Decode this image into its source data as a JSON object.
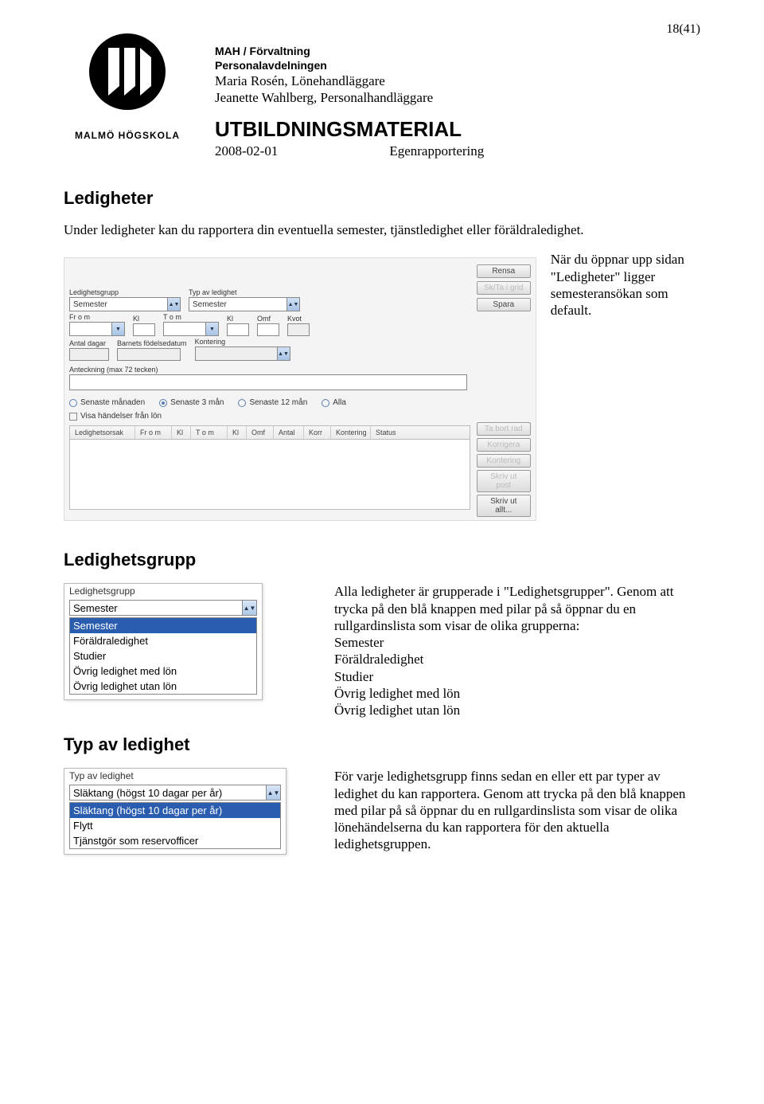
{
  "page_number": "18(41)",
  "logo_text": "MALMÖ HÖGSKOLA",
  "header": {
    "org": "MAH / Förvaltning",
    "dept": "Personalavdelningen",
    "line1": "Maria Rosén, Lönehandläggare",
    "line2": "Jeanette Wahlberg, Personalhandläggare",
    "doc_title": "UTBILDNINGSMATERIAL",
    "date": "2008-02-01",
    "subject": "Egenrapportering"
  },
  "section1": {
    "heading": "Ledigheter",
    "intro": "Under ledigheter kan du rapportera din eventuella semester, tjänstledighet eller föräldraledighet.",
    "side_note": "När du öppnar upp sidan \"Ledigheter\" ligger semesteransökan som default."
  },
  "form": {
    "labels": {
      "ledighetsgrupp": "Ledighetsgrupp",
      "typ_av_ledighet": "Typ av ledighet",
      "from": "Fr o m",
      "kl1": "Kl",
      "tom": "T o m",
      "kl2": "Kl",
      "omf": "Omf",
      "kvot": "Kvot",
      "antal_dagar": "Antal dagar",
      "barnets_fodelsedatum": "Barnets födelsedatum",
      "kontering": "Kontering",
      "anteckning": "Anteckning (max 72 tecken)"
    },
    "values": {
      "ledighetsgrupp": "Semester",
      "typ_av_ledighet": "Semester"
    },
    "buttons": {
      "rensa": "Rensa",
      "skta": "Sk/Ta i grid",
      "spara": "Spara"
    },
    "radios": {
      "senaste_manaden": "Senaste månaden",
      "senaste_3": "Senaste 3 mån",
      "senaste_12": "Senaste 12 mån",
      "alla": "Alla"
    },
    "visa": "Visa händelser från lön",
    "grid_cols": [
      "Ledighetsorsak",
      "Fr o m",
      "Kl",
      "T o m",
      "Kl",
      "Omf",
      "Antal",
      "Korr",
      "Kontering",
      "Status"
    ],
    "grid_buttons": {
      "tabort": "Ta bort rad",
      "korrigera": "Korrigera",
      "kontering": "Kontering",
      "skrivut": "Skriv ut post",
      "skrivutallt": "Skriv ut allt..."
    }
  },
  "section2": {
    "heading": "Ledighetsgrupp",
    "dd": {
      "label": "Ledighetsgrupp",
      "selected": "Semester",
      "options": [
        "Semester",
        "Föräldraledighet",
        "Studier",
        "Övrig ledighet med lön",
        "Övrig ledighet utan lön"
      ]
    },
    "text_intro": "Alla ledigheter är grupperade i \"Ledighetsgrupper\". Genom att trycka på den blå knappen med pilar på så öppnar du en rullgardinslista som visar de olika grupperna:",
    "bullets": [
      "Semester",
      "Föräldraledighet",
      "Studier",
      "Övrig ledighet med lön",
      "Övrig ledighet utan lön"
    ]
  },
  "section3": {
    "heading": "Typ av ledighet",
    "dd": {
      "label": "Typ av ledighet",
      "selected": "Släktang (högst 10 dagar per år)",
      "options": [
        "Släktang (högst 10 dagar per år)",
        "Flytt",
        "Tjänstgör som reservofficer"
      ]
    },
    "text": "För varje ledighetsgrupp finns sedan en eller ett par typer av ledighet du kan rapportera. Genom att trycka på den blå knappen med pilar på så öppnar du en rullgardinslista som visar de olika lönehändelserna du kan rapportera för den aktuella ledighetsgruppen."
  }
}
